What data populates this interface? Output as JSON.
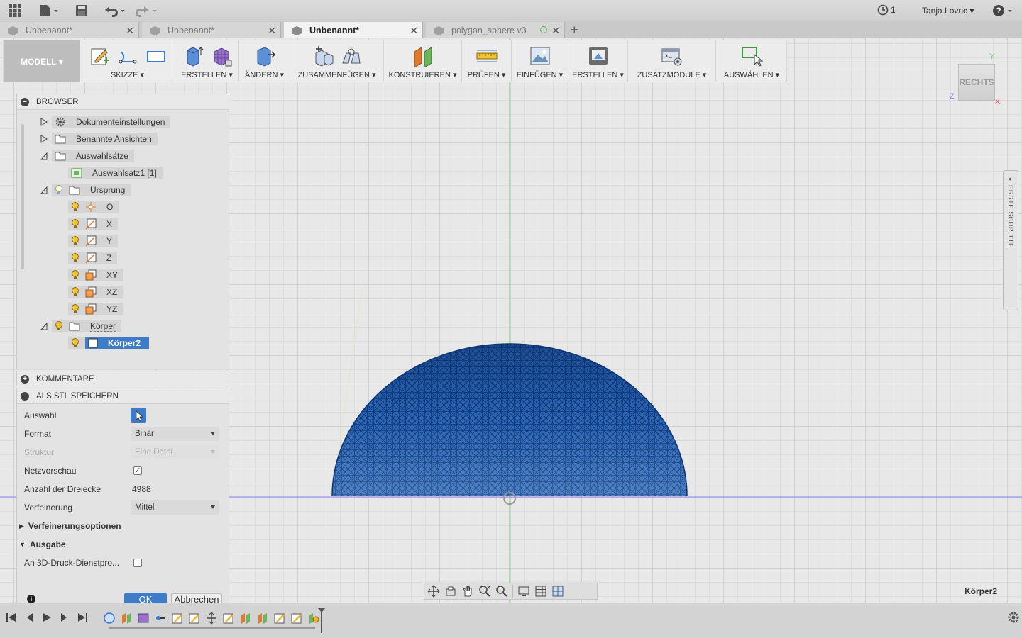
{
  "app": {
    "user_name": "Tanja Lovric",
    "job_count": "1",
    "help_label": "?"
  },
  "tabs": [
    {
      "label": "Unbenannt*",
      "active": false
    },
    {
      "label": "Unbenannt*",
      "active": false
    },
    {
      "label": "Unbenannt*",
      "active": true
    },
    {
      "label": "polygon_sphere v3",
      "active": false
    }
  ],
  "toolbar": {
    "workspace": "MODELL ▾",
    "groups": [
      {
        "label": "SKIZZE ▾"
      },
      {
        "label": "ERSTELLEN ▾"
      },
      {
        "label": "ÄNDERN ▾"
      },
      {
        "label": "ZUSAMMENFÜGEN ▾"
      },
      {
        "label": "KONSTRUIEREN ▾"
      },
      {
        "label": "PRÜFEN ▾"
      },
      {
        "label": "EINFÜGEN ▾"
      },
      {
        "label": "ERSTELLEN ▾"
      },
      {
        "label": "ZUSATZMODULE ▾"
      },
      {
        "label": "AUSWÄHLEN ▾"
      }
    ]
  },
  "viewcube": {
    "face": "RECHTS",
    "axis_x": "X",
    "axis_y": "Y",
    "axis_z": "Z"
  },
  "sidetab": {
    "label": "ERSTE SCHRITTE"
  },
  "browser": {
    "title": "BROWSER",
    "items": [
      {
        "label": "Dokumenteinstellungen"
      },
      {
        "label": "Benannte Ansichten"
      },
      {
        "label": "Auswahlsätze"
      },
      {
        "label": "Auswahlsatz1 [1]"
      },
      {
        "label": "Ursprung"
      },
      {
        "label": "O"
      },
      {
        "label": "X"
      },
      {
        "label": "Y"
      },
      {
        "label": "Z"
      },
      {
        "label": "XY"
      },
      {
        "label": "XZ"
      },
      {
        "label": "YZ"
      },
      {
        "label": "Körper"
      },
      {
        "label": "Körper2"
      }
    ]
  },
  "comments": {
    "title": "KOMMENTARE"
  },
  "stl": {
    "title": "ALS STL SPEICHERN",
    "auswahl_label": "Auswahl",
    "format_label": "Format",
    "format_value": "Binär",
    "struktur_label": "Struktur",
    "struktur_value": "Eine Datei",
    "netzvorschau_label": "Netzvorschau",
    "dreiecke_label": "Anzahl der Dreiecke",
    "dreiecke_value": "4988",
    "verfeinerung_label": "Verfeinerung",
    "verfeinerung_value": "Mittel",
    "optionen_label": "Verfeinerungsoptionen",
    "ausgabe_label": "Ausgabe",
    "druck_label": "An 3D-Druck-Dienstpro...",
    "ok_label": "OK",
    "cancel_label": "Abbrechen"
  },
  "status": {
    "selected_body": "Körper2"
  },
  "colors": {
    "accent": "#3d7cc9",
    "mesh": "#1e5aa8"
  }
}
